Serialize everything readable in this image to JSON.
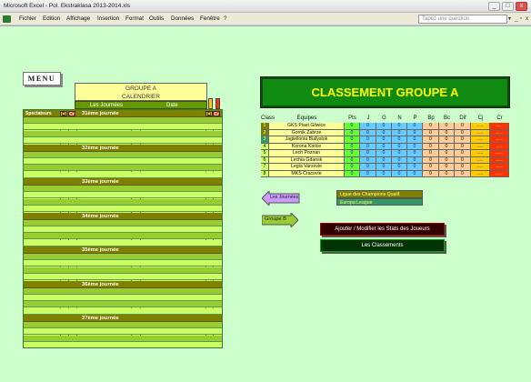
{
  "window": {
    "title": "Microsoft Excel - Pol. Ekstraklasa 2013-2014.xls",
    "btn_min": "_",
    "btn_max": "□",
    "btn_close": "x"
  },
  "menubar": {
    "items": [
      "Fichier",
      "Edition",
      "Affichage",
      "Insertion",
      "Format",
      "Outils",
      "Données",
      "Fenêtre",
      "?"
    ],
    "help_placeholder": "Tapez une question",
    "help_dropdown": "▾",
    "mdi_min": "_",
    "mdi_max": "▫",
    "mdi_close": "x"
  },
  "sheet": {
    "menu_button": "MENU",
    "groupe_title_line1": "GROUPE A",
    "groupe_title_line2": "CALENDRIER",
    "col_journees": "Les Journées",
    "col_date": "Date",
    "spectateurs": "Spectateurs",
    "yellow_card": "Cj",
    "red_card": "Cr",
    "journees": [
      "31ème journée",
      "32ème journée",
      "33ème journée",
      "34ème journée",
      "35ème journée",
      "36ème journée",
      "37ème journée"
    ],
    "colors": {
      "bg": "#ccff99",
      "journee_bar": "#808000",
      "row_dark": "#99cc33",
      "row_light": "#ccff66"
    }
  },
  "classement": {
    "title": "CLASSEMENT GROUPE A",
    "headers": [
      "Class",
      "Equipes",
      "Pts",
      "J",
      "G",
      "N",
      "P",
      "Bp",
      "Bc",
      "Dif",
      "Cj",
      "Cr"
    ],
    "rows": [
      {
        "rank": "1",
        "team": "GKS Piast Gliwice",
        "pts": "0",
        "j": "0",
        "g": "0",
        "n": "0",
        "p": "0",
        "bp": "0",
        "bc": "0",
        "dif": "0",
        "cj": ".....",
        "cr": "....."
      },
      {
        "rank": "2",
        "team": "Gornik Zabrze",
        "pts": "0",
        "j": "0",
        "g": "0",
        "n": "0",
        "p": "0",
        "bp": "0",
        "bc": "0",
        "dif": "0",
        "cj": ".....",
        "cr": "....."
      },
      {
        "rank": "3",
        "team": "Jagiellonia Bialystok",
        "pts": "0",
        "j": "0",
        "g": "0",
        "n": "0",
        "p": "0",
        "bp": "0",
        "bc": "0",
        "dif": "0",
        "cj": ".....",
        "cr": "....."
      },
      {
        "rank": "4",
        "team": "Korona Kielce",
        "pts": "0",
        "j": "0",
        "g": "0",
        "n": "0",
        "p": "0",
        "bp": "0",
        "bc": "0",
        "dif": "0",
        "cj": ".....",
        "cr": "....."
      },
      {
        "rank": "5",
        "team": "Lech Poznan",
        "pts": "0",
        "j": "0",
        "g": "0",
        "n": "0",
        "p": "0",
        "bp": "0",
        "bc": "0",
        "dif": "0",
        "cj": ".....",
        "cr": "....."
      },
      {
        "rank": "6",
        "team": "Lechia Gdansk",
        "pts": "0",
        "j": "0",
        "g": "0",
        "n": "0",
        "p": "0",
        "bp": "0",
        "bc": "0",
        "dif": "0",
        "cj": ".....",
        "cr": "....."
      },
      {
        "rank": "7",
        "team": "Legia Varsovie",
        "pts": "0",
        "j": "0",
        "g": "0",
        "n": "0",
        "p": "0",
        "bp": "0",
        "bc": "0",
        "dif": "0",
        "cj": ".....",
        "cr": "....."
      },
      {
        "rank": "8",
        "team": "MKS Cracovie",
        "pts": "0",
        "j": "0",
        "g": "0",
        "n": "0",
        "p": "0",
        "bp": "0",
        "bc": "0",
        "dif": "0",
        "cj": ".....",
        "cr": "....."
      }
    ],
    "legend_champions": "Ligue des Champions Qualif.",
    "legend_europa": "Europa League",
    "colors": {
      "title_bg": "#118a11",
      "title_fg": "#ffff00"
    }
  },
  "buttons": {
    "les_journees": "Les Journées",
    "groupe_b": "Groupe B",
    "stats": "Ajouter / Modifier les Stats des Joueurs",
    "classements": "Les Classements"
  }
}
